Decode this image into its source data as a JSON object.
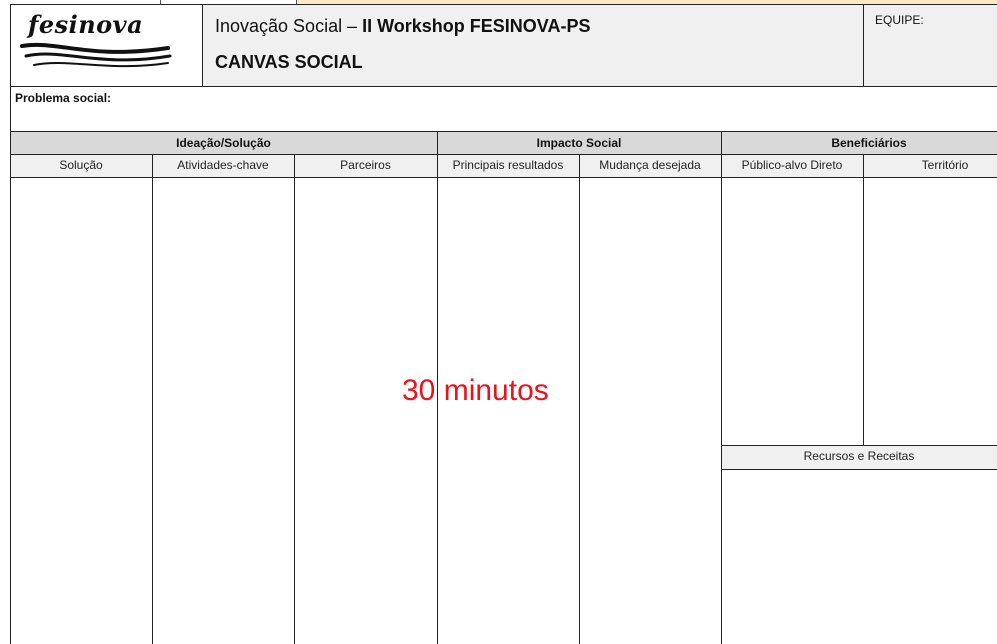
{
  "header": {
    "logo_text": "fesinova",
    "title_prefix": "Inovação Social – ",
    "title_bold": "II Workshop FESINOVA-PS",
    "subtitle": "CANVAS SOCIAL",
    "team_label": "EQUIPE:"
  },
  "problem": {
    "label": "Problema social:"
  },
  "groups": [
    {
      "label": "Ideação/Solução"
    },
    {
      "label": "Impacto Social"
    },
    {
      "label": "Beneficiários"
    }
  ],
  "columns": [
    {
      "label": "Solução"
    },
    {
      "label": "Atividades-chave"
    },
    {
      "label": "Parceiros"
    },
    {
      "label": "Principais resultados"
    },
    {
      "label": "Mudança desejada"
    },
    {
      "label": "Público-alvo Direto"
    },
    {
      "label": "Território"
    }
  ],
  "resources": {
    "label": "Recursos e Receitas"
  },
  "overlay": {
    "text": "30 minutos",
    "color": "#e8141b"
  }
}
